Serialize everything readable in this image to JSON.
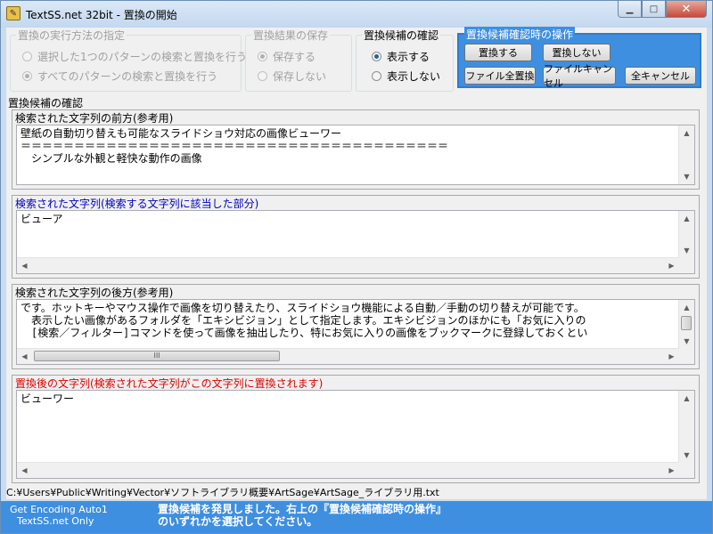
{
  "window": {
    "title": "TextSS.net 32bit - 置換の開始",
    "minimize_glyph": "▁",
    "maximize_glyph": "□",
    "close_glyph": "✕"
  },
  "exec_method": {
    "legend": "置換の実行方法の指定",
    "options": [
      {
        "label": "選択した1つのパターンの検索と置換を行う",
        "selected": false
      },
      {
        "label": "すべてのパターンの検索と置換を行う",
        "selected": true
      }
    ]
  },
  "save_result": {
    "legend": "置換結果の保存",
    "options": [
      {
        "label": "保存する",
        "selected": true
      },
      {
        "label": "保存しない",
        "selected": false
      }
    ]
  },
  "candidate_confirm": {
    "legend": "置換候補の確認",
    "options": [
      {
        "label": "表示する",
        "selected": true
      },
      {
        "label": "表示しない",
        "selected": false
      }
    ]
  },
  "operations": {
    "legend": "置換候補確認時の操作",
    "replace": "置換する",
    "no_replace": "置換しない",
    "replace_all_file": "ファイル全置換",
    "cancel_file": "ファイルキャンセル",
    "cancel_all": "全キャンセル"
  },
  "confirm_section_label": "置換候補の確認",
  "before_panel": {
    "label": "検索された文字列の前方(参考用)",
    "lines": [
      "壁紙の自動切り替えも可能なスライドショウ対応の画像ビューワー",
      "＝＝＝＝＝＝＝＝＝＝＝＝＝＝＝＝＝＝＝＝＝＝＝＝＝＝＝＝＝＝＝＝＝＝＝＝＝＝＝＝",
      "　シンプルな外観と軽快な動作の画像"
    ]
  },
  "match_panel": {
    "label": "検索された文字列(検索する文字列に該当した部分)",
    "lines": [
      "ビューア"
    ]
  },
  "after_panel": {
    "label": "検索された文字列の後方(参考用)",
    "lines": [
      "です。ホットキーやマウス操作で画像を切り替えたり、スライドショウ機能による自動／手動の切り替えが可能です。",
      "",
      "　表示したい画像があるフォルダを「エキシビジョン」として指定します。エキシビジョンのほかにも「お気に入りの",
      "　[検索／フィルター]コマンドを使って画像を抽出したり、特にお気に入りの画像をブックマークに登録しておくとい"
    ],
    "hthumb_glyph": "III"
  },
  "replaced_panel": {
    "label": "置換後の文字列(検索された文字列がこの文字列に置換されます)",
    "lines": [
      "ビューワー"
    ]
  },
  "colors": {
    "match_label": "#0000c0",
    "replaced_label": "#e00000",
    "accent": "#3e8fe0"
  },
  "path": "C:¥Users¥Public¥Writing¥Vector¥ソフトライブラリ概要¥ArtSage¥ArtSage_ライブラリ用.txt",
  "status": {
    "encoding": "Get Encoding Auto1",
    "app": "TextSS.net Only",
    "message": "置換候補を発見しました。右上の『置換候補確認時の操作』のいずれかを選択してください。"
  }
}
